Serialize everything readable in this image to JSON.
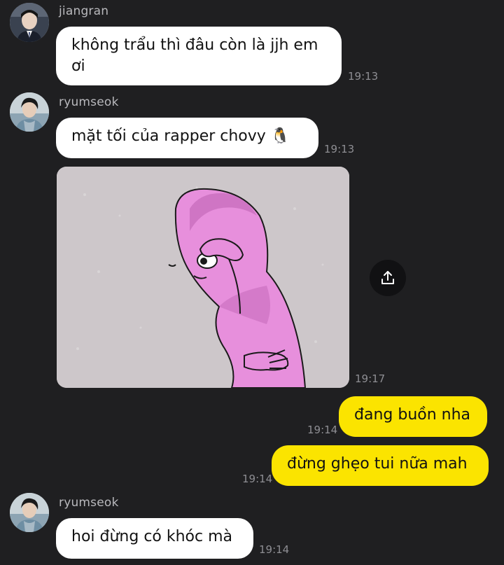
{
  "messages": [
    {
      "sender": "jiangran",
      "text": "không trẩu thì đâu còn là jjh em\nơi",
      "time": "19:13"
    },
    {
      "sender": "ryumseok",
      "text": "mặt tối của rapper chovy 🐧",
      "time": "19:13"
    },
    {
      "sender": "ryumseok",
      "image": "sad-pink-meme-image",
      "time": "19:17"
    },
    {
      "sender": "me",
      "text": "đang buồn nha",
      "time": "19:14"
    },
    {
      "sender": "me",
      "text": "đừng ghẹo tui nữa mah",
      "time": "19:14"
    },
    {
      "sender": "ryumseok",
      "text": "hoi đừng có khóc mà",
      "time": "19:14"
    }
  ],
  "icons": {
    "share": "share-upload-icon"
  },
  "colors": {
    "background": "#1f1f21",
    "incoming_bubble": "#ffffff",
    "outgoing_bubble": "#fbe400",
    "timestamp": "#8e8e93",
    "sender_name": "#b9b9bd"
  }
}
